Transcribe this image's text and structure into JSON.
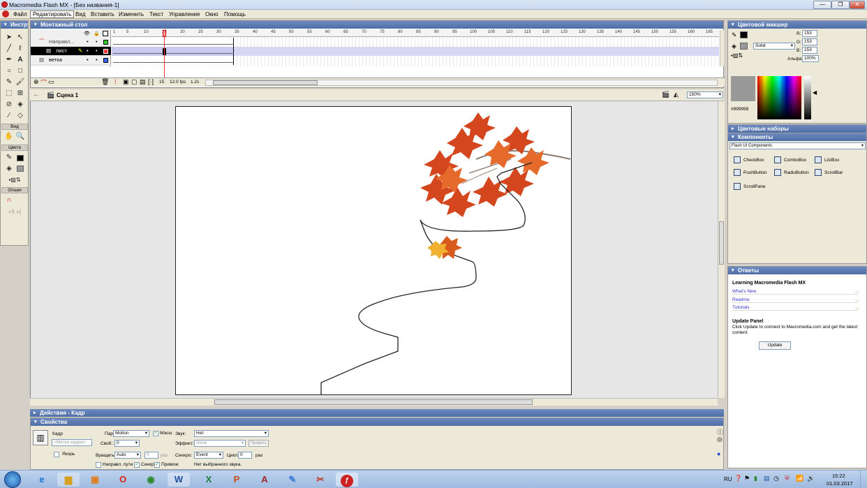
{
  "window": {
    "title": "Macromedia Flash MX - [Без названия-1]"
  },
  "menubar": {
    "items": [
      "Файл",
      "Редактировать",
      "Вид",
      "Вставить",
      "Изменить",
      "Текст",
      "Управление",
      "Окно",
      "Помощь"
    ],
    "selected": "Редактировать"
  },
  "tools": {
    "title": "Инстру",
    "view_label": "Вид",
    "colors_label": "Цвета",
    "options_label": "Опции"
  },
  "timeline": {
    "title": "Монтажный стол",
    "layers": [
      {
        "name": "Направл...",
        "type": "guide",
        "color": "#33cc33"
      },
      {
        "name": "лист",
        "type": "guided",
        "color": "#ff3333",
        "selected": true
      },
      {
        "name": "ветка",
        "type": "normal",
        "color": "#3366ff"
      }
    ],
    "ruler": [
      "1",
      "5",
      "10",
      "15",
      "20",
      "25",
      "30",
      "35",
      "40",
      "45",
      "50",
      "55",
      "60",
      "65",
      "70",
      "75",
      "80",
      "85",
      "90",
      "95",
      "100",
      "105",
      "110",
      "115",
      "120",
      "125",
      "130",
      "135",
      "140",
      "145",
      "150",
      "155",
      "160",
      "165"
    ],
    "current_frame": "15",
    "fps": "12.0 fps",
    "elapsed": "1.2s"
  },
  "scene": {
    "name": "Сцена 1",
    "zoom": "150%"
  },
  "panels": {
    "actions": "Действия - Кадр",
    "properties": "Свойства",
    "color_mixer": "Цветовой микшер",
    "color_swatches": "Цветовые наборы",
    "components": "Компоненты",
    "answers": "Ответы"
  },
  "properties": {
    "frame_label": "Кадр",
    "frame_placeholder": "<Метка кадра>",
    "anchor_label": "Якорь",
    "tween_label": "Пара:",
    "tween_value": "Motion",
    "scale_label": "Масш",
    "ease_label": "Своб.:",
    "ease_value": "0",
    "rotate_label": "Вращать",
    "rotate_value": "Auto",
    "rotate_times": "0",
    "rotate_unit": "раз",
    "orient_label": "Направл. пути",
    "sync_label": "Синхр.",
    "snap_label": "Привязк",
    "sound_label": "Звук:",
    "sound_value": "Нет",
    "effect_label": "Эффект:",
    "effect_value": "None",
    "edit_button": "Править",
    "sync2_label": "Синхро:",
    "sync2_value": "Event",
    "loop_label": "Цикл:",
    "loop_value": "0",
    "loop_unit": "раз",
    "no_sound": "Нет выбранного звука."
  },
  "color_mixer": {
    "r_label": "R:",
    "r": "153",
    "g_label": "G:",
    "g": "153",
    "b_label": "B:",
    "b": "153",
    "alpha_label": "Альфа:",
    "alpha": "100%",
    "fill_type": "Solid",
    "hex": "#999999",
    "swatch_color": "#999999"
  },
  "components": {
    "set": "Flash UI Components",
    "items": [
      "CheckBox",
      "ComboBox",
      "ListBox",
      "PushButton",
      "RadioButton",
      "ScrollBar",
      "ScrollPane"
    ]
  },
  "answers": {
    "heading": "Learning Macromedia Flash MX",
    "links": [
      "What's New",
      "Readme",
      "Tutorials"
    ],
    "update_title": "Update Panel",
    "update_text": "Click Update to connect to Macromedia.com and get the latest content.",
    "update_button": "Update"
  },
  "taskbar": {
    "lang": "RU",
    "time": "15:22",
    "date": "01.03.2017",
    "apps": [
      "explorer",
      "ie",
      "files",
      "media",
      "opera",
      "chrome",
      "word",
      "excel",
      "powerpoint",
      "access",
      "paint",
      "scissors",
      "flash"
    ]
  }
}
